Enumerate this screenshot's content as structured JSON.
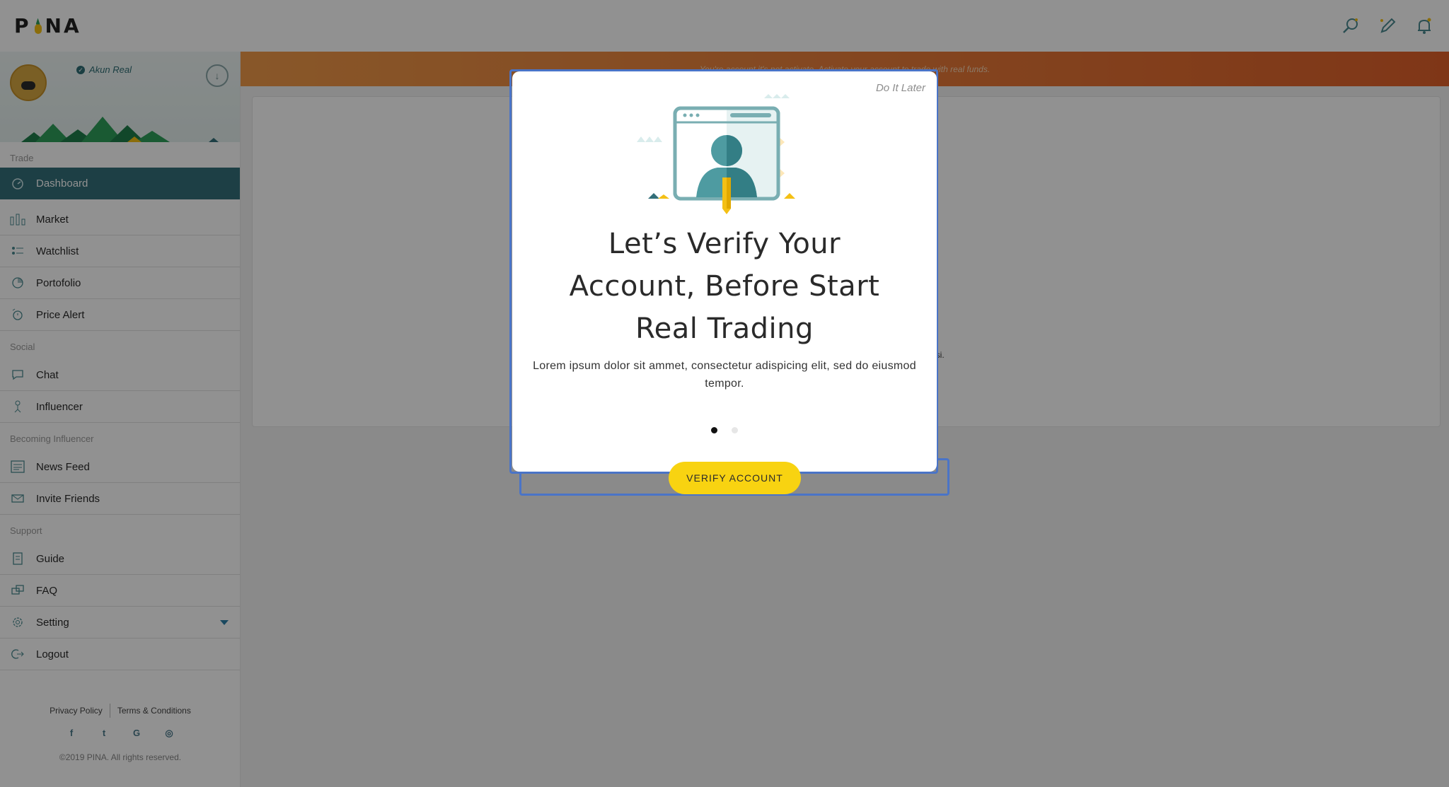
{
  "app": {
    "logo_text": "PINA"
  },
  "topbar": {
    "icons": [
      "search-icon",
      "edit-icon",
      "bell-icon"
    ]
  },
  "profile": {
    "account_label": "Akun Real"
  },
  "sidebar": {
    "sections": {
      "trade": "Trade",
      "social": "Social",
      "becoming_influencer": "Becoming Influencer",
      "support": "Support"
    },
    "items": {
      "dashboard": "Dashboard",
      "market": "Market",
      "watchlist": "Watchlist",
      "portofolio": "Portofolio",
      "price_alert": "Price Alert",
      "chat": "Chat",
      "influencer": "Influencer",
      "news_feed": "News Feed",
      "invite_friends": "Invite Friends",
      "guide": "Guide",
      "faq": "FAQ",
      "setting": "Setting",
      "logout": "Logout"
    },
    "footer": {
      "privacy": "Privacy Policy",
      "terms": "Terms & Conditions",
      "copyright": "©2019 PINA. All rights reserved.",
      "socials": {
        "facebook": "f",
        "twitter": "t",
        "google": "G",
        "instagram": "◎"
      }
    }
  },
  "banner": {
    "text": "You're account it's not activate. Activate your account to trade with real funds."
  },
  "content": {
    "snippet": "asi."
  },
  "modal": {
    "do_later": "Do It Later",
    "title_line1": "Let’s Verify Your",
    "title_line2": "Account, Before Start",
    "title_line3": "Real Trading",
    "description": "Lorem ipsum dolor sit ammet, consectetur adispicing elit, sed do eiusmod tempor.",
    "verify_button": "VERIFY ACCOUNT",
    "pagination": {
      "current": 1,
      "total": 2
    }
  },
  "colors": {
    "accent_teal": "#336f79",
    "banner_orange": "#e0602a",
    "button_yellow": "#f8d311"
  }
}
